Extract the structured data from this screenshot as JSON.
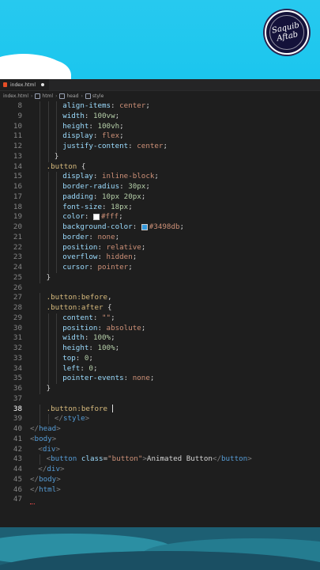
{
  "watermark": {
    "line1": "Saquib",
    "line2": "Aftab"
  },
  "tab": {
    "filename": "index.html",
    "icon": "html-file-icon"
  },
  "breadcrumb": [
    "index.html",
    "html",
    "head",
    "style"
  ],
  "colors": {
    "background": "#1e1e1e",
    "property": "#9cdcfe",
    "string": "#ce9178",
    "selector": "#d7ba7d",
    "swatch_white": "#ffffff",
    "swatch_blue": "#3498db"
  },
  "code": {
    "active_line": 38,
    "lines": [
      {
        "n": 8,
        "indent": 4,
        "parts": [
          [
            "prop",
            "align-items"
          ],
          [
            "",
            "："
          ],
          [
            "val",
            "center"
          ],
          [
            "",
            ";"
          ]
        ]
      },
      {
        "n": 9,
        "indent": 4,
        "parts": [
          [
            "prop",
            "width"
          ],
          [
            "",
            ": "
          ],
          [
            "num",
            "100vw"
          ],
          [
            "",
            ";"
          ]
        ]
      },
      {
        "n": 10,
        "indent": 4,
        "parts": [
          [
            "prop",
            "height"
          ],
          [
            "",
            ": "
          ],
          [
            "num",
            "100vh"
          ],
          [
            "",
            ";"
          ]
        ]
      },
      {
        "n": 11,
        "indent": 4,
        "parts": [
          [
            "prop",
            "display"
          ],
          [
            "",
            ": "
          ],
          [
            "val",
            "flex"
          ],
          [
            "",
            ";"
          ]
        ]
      },
      {
        "n": 12,
        "indent": 4,
        "parts": [
          [
            "prop",
            "justify-content"
          ],
          [
            "",
            ": "
          ],
          [
            "val",
            "center"
          ],
          [
            "",
            ";"
          ]
        ]
      },
      {
        "n": 13,
        "indent": 3,
        "parts": [
          [
            "",
            "}"
          ]
        ]
      },
      {
        "n": 14,
        "indent": 2,
        "parts": [
          [
            "sel",
            ".button"
          ],
          [
            "",
            " {"
          ]
        ]
      },
      {
        "n": 15,
        "indent": 4,
        "parts": [
          [
            "prop",
            "display"
          ],
          [
            "",
            ": "
          ],
          [
            "val",
            "inline-block"
          ],
          [
            "",
            ";"
          ]
        ]
      },
      {
        "n": 16,
        "indent": 4,
        "parts": [
          [
            "prop",
            "border-radius"
          ],
          [
            "",
            ": "
          ],
          [
            "num",
            "30px"
          ],
          [
            "",
            ";"
          ]
        ]
      },
      {
        "n": 17,
        "indent": 4,
        "parts": [
          [
            "prop",
            "padding"
          ],
          [
            "",
            ": "
          ],
          [
            "num",
            "10px 20px"
          ],
          [
            "",
            ";"
          ]
        ]
      },
      {
        "n": 18,
        "indent": 4,
        "parts": [
          [
            "prop",
            "font-size"
          ],
          [
            "",
            ": "
          ],
          [
            "num",
            "18px"
          ],
          [
            "",
            ";"
          ]
        ]
      },
      {
        "n": 19,
        "indent": 4,
        "parts": [
          [
            "prop",
            "color"
          ],
          [
            "",
            ": "
          ],
          [
            "swatch",
            "#ffffff"
          ],
          [
            "val",
            "#fff"
          ],
          [
            "",
            ";"
          ]
        ]
      },
      {
        "n": 20,
        "indent": 4,
        "parts": [
          [
            "prop",
            "background-color"
          ],
          [
            "",
            ": "
          ],
          [
            "swatch",
            "#3498db"
          ],
          [
            "val",
            "#3498db"
          ],
          [
            "",
            ";"
          ]
        ]
      },
      {
        "n": 21,
        "indent": 4,
        "parts": [
          [
            "prop",
            "border"
          ],
          [
            "",
            ": "
          ],
          [
            "val",
            "none"
          ],
          [
            "",
            ";"
          ]
        ]
      },
      {
        "n": 22,
        "indent": 4,
        "parts": [
          [
            "prop",
            "position"
          ],
          [
            "",
            ": "
          ],
          [
            "val",
            "relative"
          ],
          [
            "",
            ";"
          ]
        ]
      },
      {
        "n": 23,
        "indent": 4,
        "parts": [
          [
            "prop",
            "overflow"
          ],
          [
            "",
            ": "
          ],
          [
            "val",
            "hidden"
          ],
          [
            "",
            ";"
          ]
        ]
      },
      {
        "n": 24,
        "indent": 4,
        "parts": [
          [
            "prop",
            "cursor"
          ],
          [
            "",
            ": "
          ],
          [
            "val",
            "pointer"
          ],
          [
            "",
            ";"
          ]
        ]
      },
      {
        "n": 25,
        "indent": 2,
        "parts": [
          [
            "",
            "}"
          ]
        ]
      },
      {
        "n": 26,
        "indent": 0,
        "parts": []
      },
      {
        "n": 27,
        "indent": 2,
        "parts": [
          [
            "sel",
            ".button:before"
          ],
          [
            "",
            ","
          ]
        ]
      },
      {
        "n": 28,
        "indent": 2,
        "parts": [
          [
            "sel",
            ".button:after"
          ],
          [
            "",
            " {"
          ]
        ]
      },
      {
        "n": 29,
        "indent": 4,
        "parts": [
          [
            "prop",
            "content"
          ],
          [
            "",
            ": "
          ],
          [
            "val",
            "\"\""
          ],
          [
            "",
            ";"
          ]
        ]
      },
      {
        "n": 30,
        "indent": 4,
        "parts": [
          [
            "prop",
            "position"
          ],
          [
            "",
            ": "
          ],
          [
            "val",
            "absolute"
          ],
          [
            "",
            ";"
          ]
        ]
      },
      {
        "n": 31,
        "indent": 4,
        "parts": [
          [
            "prop",
            "width"
          ],
          [
            "",
            ": "
          ],
          [
            "num",
            "100%"
          ],
          [
            "",
            ";"
          ]
        ]
      },
      {
        "n": 32,
        "indent": 4,
        "parts": [
          [
            "prop",
            "height"
          ],
          [
            "",
            ": "
          ],
          [
            "num",
            "100%"
          ],
          [
            "",
            ";"
          ]
        ]
      },
      {
        "n": 33,
        "indent": 4,
        "parts": [
          [
            "prop",
            "top"
          ],
          [
            "",
            ": "
          ],
          [
            "num",
            "0"
          ],
          [
            "",
            ";"
          ]
        ]
      },
      {
        "n": 34,
        "indent": 4,
        "parts": [
          [
            "prop",
            "left"
          ],
          [
            "",
            ": "
          ],
          [
            "num",
            "0"
          ],
          [
            "",
            ";"
          ]
        ]
      },
      {
        "n": 35,
        "indent": 4,
        "parts": [
          [
            "prop",
            "pointer-events"
          ],
          [
            "",
            ": "
          ],
          [
            "val",
            "none"
          ],
          [
            "",
            ";"
          ]
        ]
      },
      {
        "n": 36,
        "indent": 2,
        "parts": [
          [
            "",
            "}"
          ]
        ]
      },
      {
        "n": 37,
        "indent": 0,
        "parts": []
      },
      {
        "n": 38,
        "indent": 2,
        "parts": [
          [
            "sel",
            ".button:before"
          ],
          [
            "",
            " "
          ],
          [
            "cursor",
            ""
          ]
        ]
      },
      {
        "n": 39,
        "indent": 3,
        "parts": [
          [
            "tag",
            "</"
          ],
          [
            "tagname",
            "style"
          ],
          [
            "tag",
            ">"
          ]
        ]
      },
      {
        "n": 40,
        "indent": 0,
        "parts": [
          [
            "tag",
            "</"
          ],
          [
            "tagname",
            "head"
          ],
          [
            "tag",
            ">"
          ]
        ]
      },
      {
        "n": 41,
        "indent": 0,
        "parts": [
          [
            "tag",
            "<"
          ],
          [
            "tagname",
            "body"
          ],
          [
            "tag",
            ">"
          ]
        ]
      },
      {
        "n": 42,
        "indent": 1,
        "parts": [
          [
            "tag",
            "<"
          ],
          [
            "tagname",
            "div"
          ],
          [
            "tag",
            ">"
          ]
        ]
      },
      {
        "n": 43,
        "indent": 2,
        "parts": [
          [
            "tag",
            "<"
          ],
          [
            "tagname",
            "button"
          ],
          [
            "",
            " "
          ],
          [
            "attr",
            "class"
          ],
          [
            "",
            "="
          ],
          [
            "str",
            "\"button\""
          ],
          [
            "tag",
            ">"
          ],
          [
            "",
            "Animated Button"
          ],
          [
            "tag",
            "</"
          ],
          [
            "tagname",
            "button"
          ],
          [
            "tag",
            ">"
          ]
        ]
      },
      {
        "n": 44,
        "indent": 1,
        "parts": [
          [
            "tag",
            "</"
          ],
          [
            "tagname",
            "div"
          ],
          [
            "tag",
            ">"
          ]
        ]
      },
      {
        "n": 45,
        "indent": 0,
        "parts": [
          [
            "tag",
            "</"
          ],
          [
            "tagname",
            "body"
          ],
          [
            "tag",
            ">"
          ]
        ]
      },
      {
        "n": 46,
        "indent": 0,
        "parts": [
          [
            "tag",
            "</"
          ],
          [
            "tagname",
            "html"
          ],
          [
            "tag",
            ">"
          ]
        ]
      },
      {
        "n": 47,
        "indent": 0,
        "parts": []
      }
    ]
  }
}
